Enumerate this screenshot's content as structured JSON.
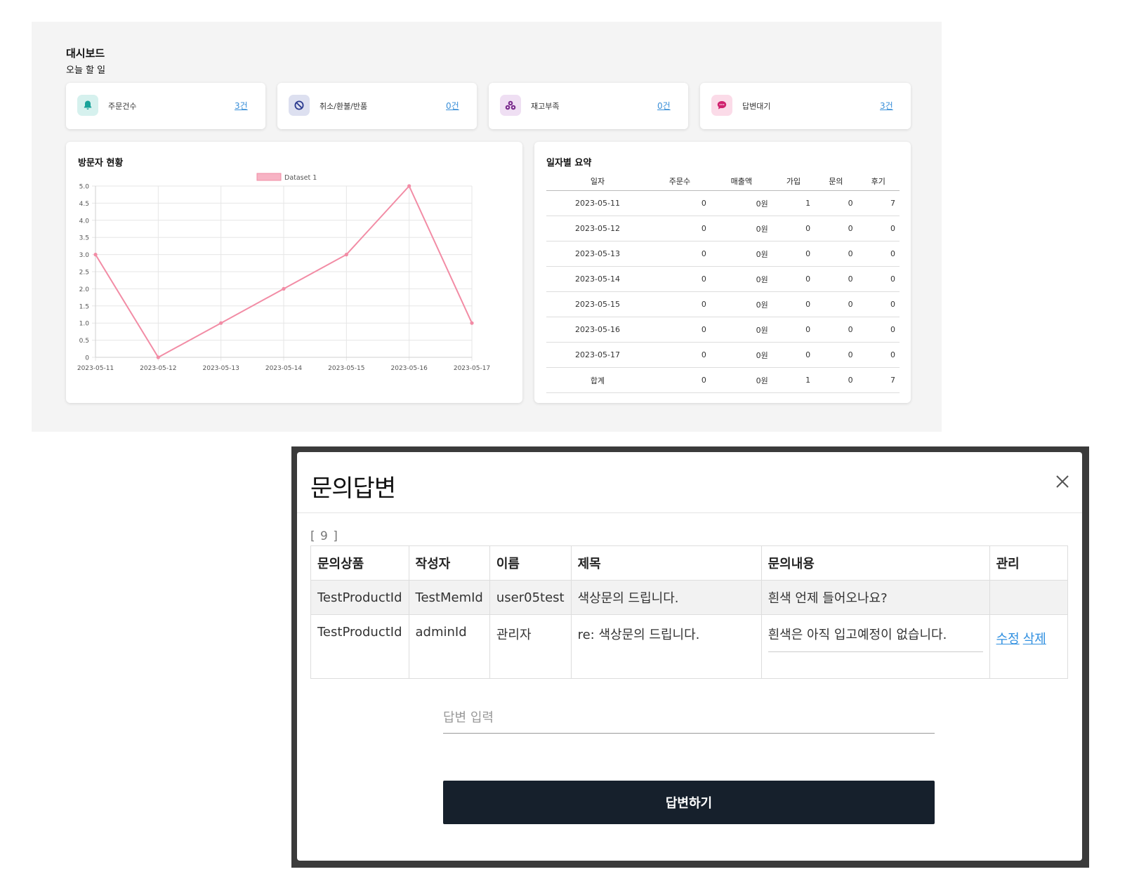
{
  "dashboard": {
    "title": "대시보드",
    "subtitle": "오늘 할 일",
    "todo_cards": [
      {
        "label": "주문건수",
        "count": "3건",
        "icon": "bell-icon",
        "icon_color": "#1aa39a",
        "icon_bg": "#d6f1ee"
      },
      {
        "label": "취소/환불/반품",
        "count": "0건",
        "icon": "prohibited-icon",
        "icon_color": "#2b3a8f",
        "icon_bg": "#dde0f0"
      },
      {
        "label": "재고부족",
        "count": "0건",
        "icon": "boxes-icon",
        "icon_color": "#7b2d8e",
        "icon_bg": "#efdff3"
      },
      {
        "label": "답변대기",
        "count": "3건",
        "icon": "chat-bubble-icon",
        "icon_color": "#d0216e",
        "icon_bg": "#fbdbe8"
      }
    ],
    "visitor_panel": {
      "title": "방문자 현황"
    },
    "summary_panel": {
      "title": "일자별 요약",
      "columns": [
        "일자",
        "주문수",
        "매출액",
        "가입",
        "문의",
        "후기"
      ],
      "rows": [
        [
          "2023-05-11",
          "0",
          "0원",
          "1",
          "0",
          "7"
        ],
        [
          "2023-05-12",
          "0",
          "0원",
          "0",
          "0",
          "0"
        ],
        [
          "2023-05-13",
          "0",
          "0원",
          "0",
          "0",
          "0"
        ],
        [
          "2023-05-14",
          "0",
          "0원",
          "0",
          "0",
          "0"
        ],
        [
          "2023-05-15",
          "0",
          "0원",
          "0",
          "0",
          "0"
        ],
        [
          "2023-05-16",
          "0",
          "0원",
          "0",
          "0",
          "0"
        ],
        [
          "2023-05-17",
          "0",
          "0원",
          "0",
          "0",
          "0"
        ],
        [
          "합계",
          "0",
          "0원",
          "1",
          "0",
          "7"
        ]
      ]
    }
  },
  "chart_data": {
    "type": "line",
    "title": "",
    "xlabel": "",
    "ylabel": "",
    "x": [
      "2023-05-11",
      "2023-05-12",
      "2023-05-13",
      "2023-05-14",
      "2023-05-15",
      "2023-05-16",
      "2023-05-17"
    ],
    "series": [
      {
        "name": "Dataset 1",
        "values": [
          3,
          0,
          1,
          2,
          3,
          5,
          1
        ],
        "color": "#f28ca5"
      }
    ],
    "ylim": [
      0,
      5
    ],
    "yticks": [
      "0",
      "0.5",
      "1.0",
      "1.5",
      "2.0",
      "2.5",
      "3.0",
      "3.5",
      "4.0",
      "4.5",
      "5.0"
    ],
    "grid": true,
    "legend": "top-center"
  },
  "modal": {
    "title": "문의답변",
    "inquiry_id": "[ 9 ]",
    "columns": [
      "문의상품",
      "작성자",
      "이름",
      "제목",
      "문의내용",
      "관리"
    ],
    "rows": [
      {
        "product": "TestProductId",
        "writer": "TestMemId",
        "name": "user05test",
        "subject": "색상문의 드립니다.",
        "content": "흰색 언제 들어오나요?"
      },
      {
        "product": "TestProductId",
        "writer": "adminId",
        "name": "관리자",
        "subject": "re: 색상문의 드립니다.",
        "content": "흰색은 아직 입고예정이 없습니다.",
        "edit_label": "수정",
        "delete_label": "삭제"
      }
    ],
    "answer_placeholder": "답변 입력",
    "submit_label": "답변하기"
  }
}
